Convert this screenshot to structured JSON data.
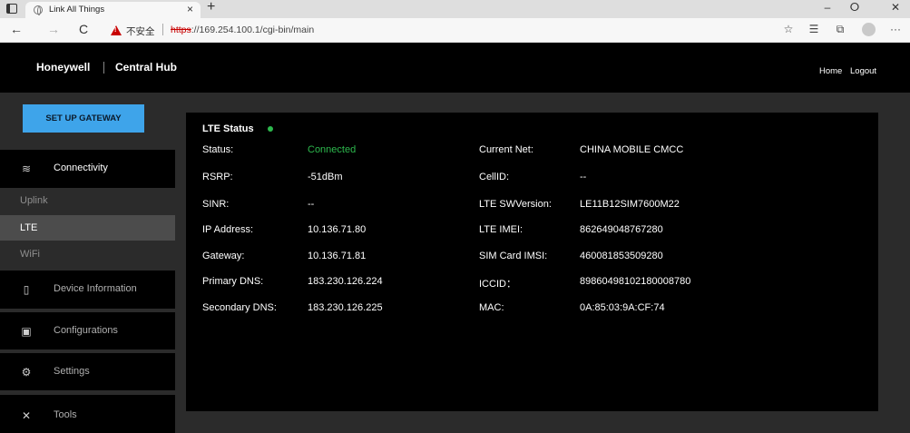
{
  "browser": {
    "tab_title": "Link All Things",
    "tab_close": "×",
    "new_tab": "+",
    "minimize": "–",
    "restore": "ⵔ",
    "close": "✕",
    "back": "←",
    "forward": "→",
    "reload": "C",
    "security_label": "不安全",
    "url_scheme": "https",
    "url_rest": "://169.254.100.1/cgi-bin/main",
    "more": "···"
  },
  "header": {
    "brand": "Honeywell",
    "product": "Central Hub",
    "home_link": "Home",
    "logout_link": "Logout"
  },
  "sidebar": {
    "setup_button": "SET UP GATEWAY",
    "connectivity": "Connectivity",
    "sub_items": [
      "Uplink",
      "LTE",
      "WiFi"
    ],
    "device_information": "Device Information",
    "configurations": "Configurations",
    "settings": "Settings",
    "tools": "Tools"
  },
  "lte": {
    "title": "LTE Status",
    "status_color": "#2db84d",
    "left": [
      {
        "label": "Status:",
        "value": "Connected"
      },
      {
        "label": "RSRP:",
        "value": "-51dBm"
      },
      {
        "label": "SINR:",
        "value": "--"
      },
      {
        "label": "IP Address:",
        "value": "10.136.71.80"
      },
      {
        "label": "Gateway:",
        "value": "10.136.71.81"
      },
      {
        "label": "Primary DNS:",
        "value": "183.230.126.224"
      },
      {
        "label": "Secondary DNS:",
        "value": "183.230.126.225"
      }
    ],
    "right": [
      {
        "label": "Current Net:",
        "value": "CHINA MOBILE CMCC"
      },
      {
        "label": "CellID:",
        "value": "--"
      },
      {
        "label": "LTE SWVersion:",
        "value": "LE11B12SIM7600M22"
      },
      {
        "label": "LTE IMEI:",
        "value": "862649048767280"
      },
      {
        "label": "SIM Card IMSI:",
        "value": "460081853509280"
      },
      {
        "label": "ICCID：",
        "value": "89860498102180008780"
      },
      {
        "label": "MAC:",
        "value": "0A:85:03:9A:CF:74"
      }
    ]
  }
}
